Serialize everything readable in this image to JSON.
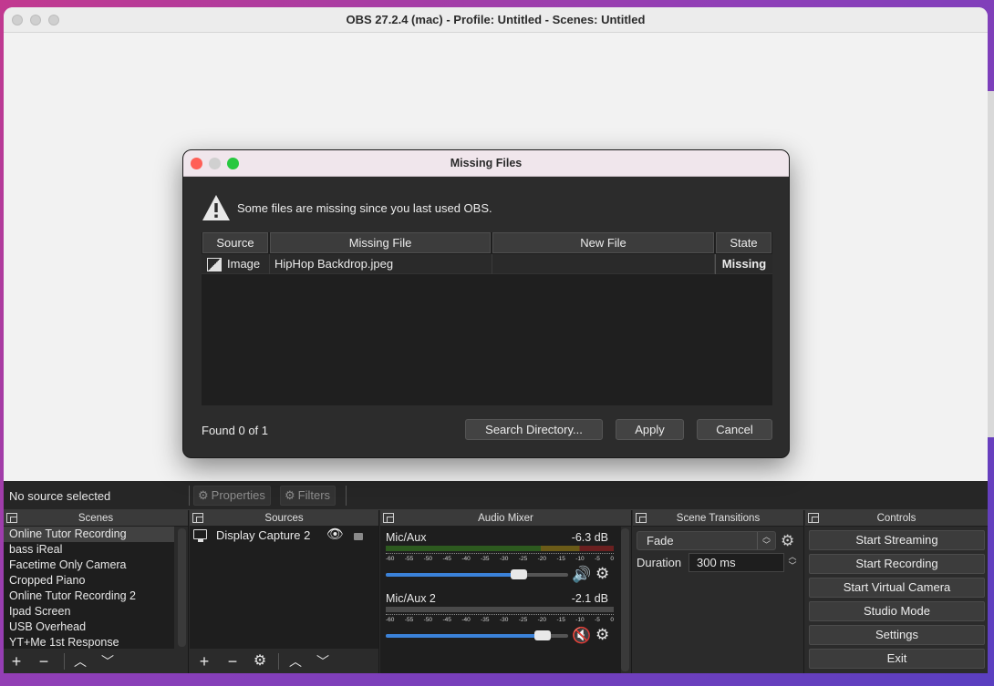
{
  "window": {
    "title": "OBS 27.2.4 (mac) - Profile: Untitled - Scenes: Untitled"
  },
  "context_bar": {
    "status": "No source selected",
    "properties_label": "Properties",
    "filters_label": "Filters"
  },
  "scenes": {
    "header": "Scenes",
    "items": [
      "Online Tutor Recording",
      "bass iReal",
      "Facetime Only Camera",
      "Cropped Piano",
      "Online Tutor Recording 2",
      "Ipad Screen",
      "USB Overhead",
      "YT+Me 1st Response"
    ],
    "selected_index": 0
  },
  "sources": {
    "header": "Sources",
    "items": [
      {
        "label": "Display Capture 2",
        "icon": "monitor-icon",
        "visible": true,
        "locked": false
      }
    ]
  },
  "audio_mixer": {
    "header": "Audio Mixer",
    "scale": [
      "-60",
      "-55",
      "-50",
      "-45",
      "-40",
      "-35",
      "-30",
      "-25",
      "-20",
      "-15",
      "-10",
      "-5",
      "0"
    ],
    "channels": [
      {
        "name": "Mic/Aux",
        "db": "-6.3 dB",
        "volume_fraction": 0.73,
        "muted": false
      },
      {
        "name": "Mic/Aux 2",
        "db": "-2.1 dB",
        "volume_fraction": 0.86,
        "muted": true
      }
    ]
  },
  "scene_transitions": {
    "header": "Scene Transitions",
    "transition": "Fade",
    "duration_label": "Duration",
    "duration_value": "300 ms"
  },
  "controls": {
    "header": "Controls",
    "buttons": [
      "Start Streaming",
      "Start Recording",
      "Start Virtual Camera",
      "Studio Mode",
      "Settings",
      "Exit"
    ]
  },
  "dialog": {
    "title": "Missing Files",
    "message": "Some files are missing since you last used OBS.",
    "columns": [
      "Source",
      "Missing File",
      "New File",
      "State"
    ],
    "rows": [
      {
        "source": "Image",
        "missing_file": "HipHop Backdrop.jpeg",
        "new_file": "",
        "state": "Missing"
      }
    ],
    "found": "Found 0 of 1",
    "search_label": "Search Directory...",
    "apply_label": "Apply",
    "cancel_label": "Cancel",
    "colors": {
      "close": "#ff5f57",
      "minimize": "#d0d0d0",
      "zoom": "#28c840"
    }
  }
}
